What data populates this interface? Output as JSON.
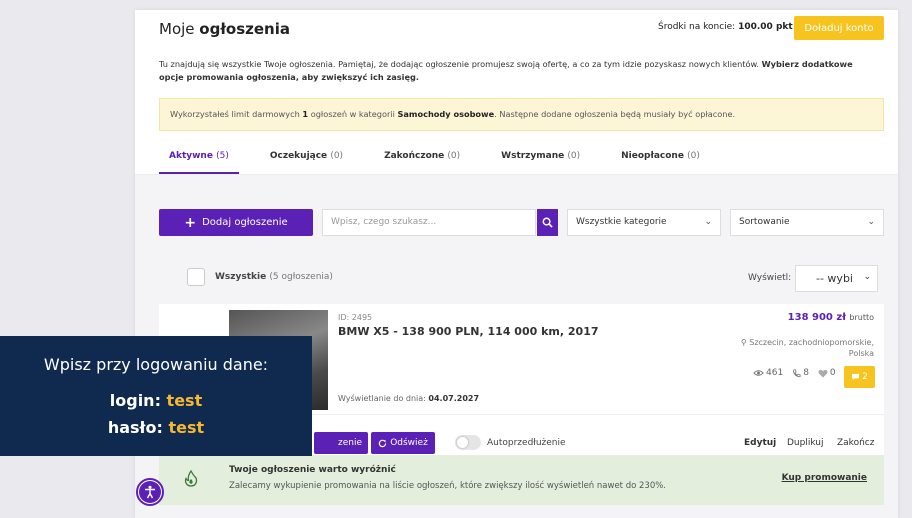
{
  "header": {
    "title_prefix": "Moje",
    "title_bold": "ogłoszenia",
    "balance_label": "Środki na koncie:",
    "balance_value": "100.00 pkt",
    "topup_label": "Doładuj konto"
  },
  "intro": {
    "text": "Tu znajdują się wszystkie Twoje ogłoszenia. Pamiętaj, że dodając ogłoszenie promujesz swoją ofertę, a co za tym idzie pozyskasz nowych klientów.",
    "bold": "Wybierz dodatkowe opcje promowania ogłoszenia, aby zwiększyć ich zasięg."
  },
  "notice": {
    "part1": "Wykorzystałeś limit darmowych",
    "count": "1",
    "part2": "ogłoszeń w kategorii",
    "category": "Samochody osobowe",
    "part3": ". Następne dodane ogłoszenia będą musiały być opłacone."
  },
  "tabs": [
    {
      "label": "Aktywne",
      "count": "(5)"
    },
    {
      "label": "Oczekujące",
      "count": "(0)"
    },
    {
      "label": "Zakończone",
      "count": "(0)"
    },
    {
      "label": "Wstrzymane",
      "count": "(0)"
    },
    {
      "label": "Nieopłacone",
      "count": "(0)"
    }
  ],
  "toolbar": {
    "add_label": "Dodaj ogłoszenie",
    "search_placeholder": "Wpisz, czego szukasz...",
    "category_select": "Wszystkie kategorie",
    "sort_select": "Sortowanie"
  },
  "list": {
    "all_label": "Wszystkie",
    "all_count": "(5 ogłoszenia)",
    "show_label": "Wyświetl:",
    "show_value": "-- wybi"
  },
  "ad": {
    "id": "ID: 2495",
    "title": "BMW X5 - 138 900 PLN, 114 000 km, 2017",
    "price": "138 900 zł",
    "price_type": "brutto",
    "location": "Szczecin, zachodniopomorskie, Polska",
    "views": "461",
    "calls": "8",
    "likes": "0",
    "messages": "2",
    "validity_label": "Wyświetlanie do dnia:",
    "validity_date": "04.07.2027"
  },
  "actions": {
    "edit_partial": "zenie",
    "refresh": "Odśwież",
    "auto_renew": "Autoprzedłużenie",
    "edit": "Edytuj",
    "duplicate": "Duplikuj",
    "end": "Zakończ"
  },
  "promo": {
    "title": "Twoje ogłoszenie warto wyróżnić",
    "text": "Zalecamy wykupienie promowania na liście ogłoszeń, które zwiększy ilość wyświetleń nawet do 230%.",
    "link": "Kup promowanie"
  },
  "overlay": {
    "line1": "Wpisz przy logowaniu dane:",
    "login_label": "login:",
    "login_value": "test",
    "password_label": "hasło:",
    "password_value": "test"
  },
  "colors": {
    "accent": "#5b21b6",
    "yellow": "#f7c31e",
    "overlay_bg": "#0f2a4e",
    "promo_bg": "#e3eedd"
  }
}
